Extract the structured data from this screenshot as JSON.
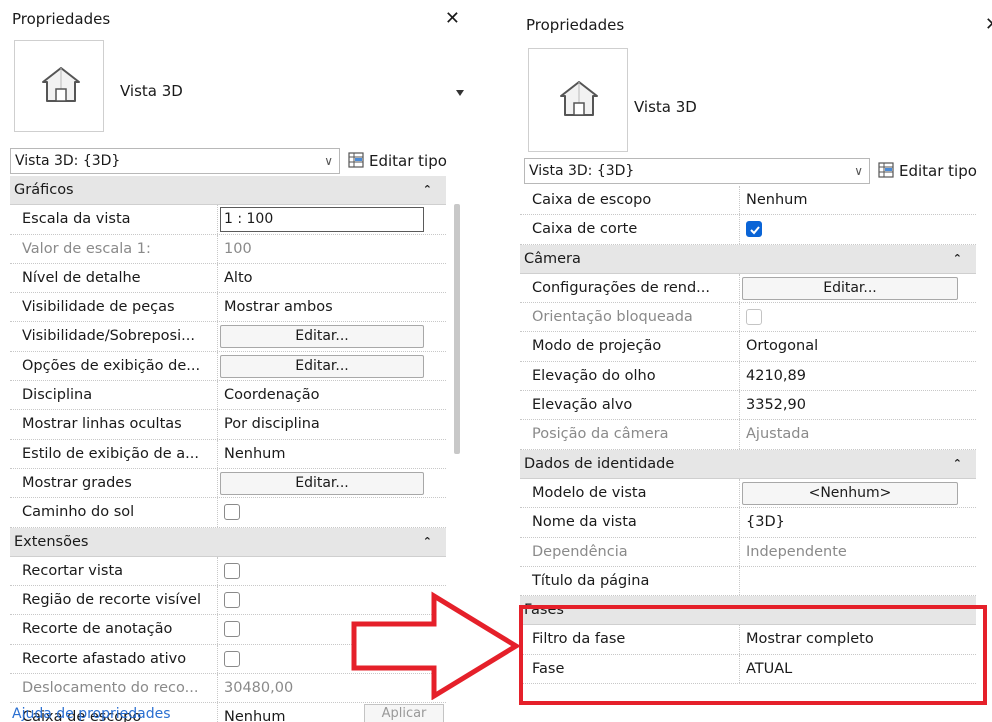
{
  "left_panel": {
    "title": "Propriedades",
    "close_glyph": "✕",
    "type_name": "Vista 3D",
    "view_selector": "Vista 3D: {3D}",
    "edit_type": "Editar tipo",
    "rows": [
      {
        "kind": "category",
        "label": "Gráficos"
      },
      {
        "kind": "prop",
        "name": "Escala da vista",
        "control": "editbox",
        "value": "1 : 100"
      },
      {
        "kind": "prop",
        "name": "Valor de escala    1:",
        "value": "100",
        "disabled": true
      },
      {
        "kind": "prop",
        "name": "Nível de detalhe",
        "value": "Alto"
      },
      {
        "kind": "prop",
        "name": "Visibilidade de peças",
        "value": "Mostrar ambos"
      },
      {
        "kind": "prop",
        "name": "Visibilidade/Sobreposi...",
        "control": "button",
        "value": "Editar..."
      },
      {
        "kind": "prop",
        "name": "Opções de exibição de...",
        "control": "button",
        "value": "Editar..."
      },
      {
        "kind": "prop",
        "name": "Disciplina",
        "value": "Coordenação"
      },
      {
        "kind": "prop",
        "name": "Mostrar linhas ocultas",
        "value": "Por disciplina"
      },
      {
        "kind": "prop",
        "name": "Estilo de exibição de a...",
        "value": "Nenhum"
      },
      {
        "kind": "prop",
        "name": "Mostrar grades",
        "control": "button",
        "value": "Editar..."
      },
      {
        "kind": "prop",
        "name": "Caminho do sol",
        "control": "checkbox",
        "checked": false
      },
      {
        "kind": "category",
        "label": "Extensões"
      },
      {
        "kind": "prop",
        "name": "Recortar vista",
        "control": "checkbox",
        "checked": false
      },
      {
        "kind": "prop",
        "name": "Região de recorte visível",
        "control": "checkbox",
        "checked": false
      },
      {
        "kind": "prop",
        "name": "Recorte de anotação",
        "control": "checkbox",
        "checked": false
      },
      {
        "kind": "prop",
        "name": "Recorte afastado ativo",
        "control": "checkbox",
        "checked": false
      },
      {
        "kind": "prop",
        "name": "Deslocamento do reco...",
        "value": "30480,00",
        "disabled": true
      },
      {
        "kind": "prop",
        "name": "Caixa de escopo",
        "value": "Nenhum"
      }
    ],
    "help_link": "Ajuda de propriedades",
    "apply_button": "Aplicar"
  },
  "right_panel": {
    "title": "Propriedades",
    "close_glyph": "✕",
    "type_name": "Vista 3D",
    "view_selector": "Vista 3D: {3D}",
    "edit_type": "Editar tipo",
    "rows": [
      {
        "kind": "prop",
        "name": "Caixa de escopo",
        "value": "Nenhum"
      },
      {
        "kind": "prop",
        "name": "Caixa de corte",
        "control": "checkbox",
        "checked": true
      },
      {
        "kind": "category",
        "label": "Câmera"
      },
      {
        "kind": "prop",
        "name": "Configurações de rend...",
        "control": "button",
        "value": "Editar..."
      },
      {
        "kind": "prop",
        "name": "Orientação bloqueada",
        "control": "checkbox",
        "checked": false,
        "disabled": true
      },
      {
        "kind": "prop",
        "name": "Modo de projeção",
        "value": "Ortogonal"
      },
      {
        "kind": "prop",
        "name": "Elevação do olho",
        "value": "4210,89"
      },
      {
        "kind": "prop",
        "name": "Elevação alvo",
        "value": "3352,90"
      },
      {
        "kind": "prop",
        "name": "Posição da câmera",
        "value": "Ajustada",
        "disabled": true
      },
      {
        "kind": "category",
        "label": "Dados de identidade"
      },
      {
        "kind": "prop",
        "name": "Modelo de vista",
        "control": "button",
        "value": "<Nenhum>"
      },
      {
        "kind": "prop",
        "name": "Nome da vista",
        "value": "{3D}"
      },
      {
        "kind": "prop",
        "name": "Dependência",
        "value": "Independente",
        "disabled": true
      },
      {
        "kind": "prop",
        "name": "Título da página",
        "value": ""
      },
      {
        "kind": "category",
        "label": "Fases"
      },
      {
        "kind": "prop",
        "name": "Filtro da fase",
        "value": "Mostrar completo"
      },
      {
        "kind": "prop",
        "name": "Fase",
        "value": "ATUAL"
      }
    ]
  },
  "colors": {
    "highlight_box": "#e5202a",
    "checkbox_checked": "#0a64d6",
    "category_bg": "#e6e6e6"
  },
  "icons": [
    "house-icon",
    "close-icon",
    "edit-type-icon",
    "chevron-down-icon",
    "collapse-icon",
    "checkmark-icon",
    "arrow-right-icon"
  ]
}
